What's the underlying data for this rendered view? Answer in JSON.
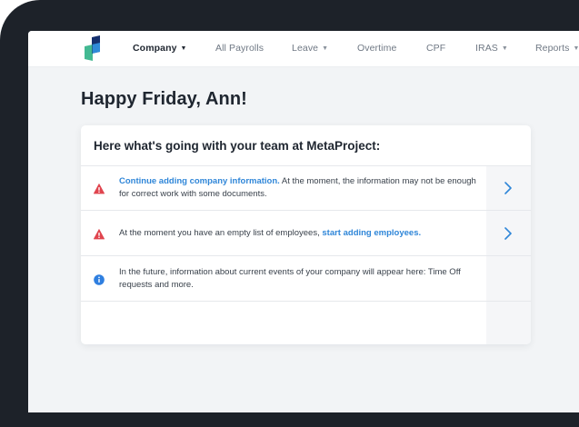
{
  "nav": {
    "items": [
      {
        "label": "Company",
        "active": true,
        "dropdown": true
      },
      {
        "label": "All Payrolls",
        "active": false,
        "dropdown": false
      },
      {
        "label": "Leave",
        "active": false,
        "dropdown": true
      },
      {
        "label": "Overtime",
        "active": false,
        "dropdown": false
      },
      {
        "label": "CPF",
        "active": false,
        "dropdown": false
      },
      {
        "label": "IRAS",
        "active": false,
        "dropdown": true
      },
      {
        "label": "Reports",
        "active": false,
        "dropdown": true
      }
    ],
    "caret": "▼"
  },
  "greeting": "Happy Friday, Ann!",
  "card": {
    "title": "Here what's going with your team at MetaProject:",
    "rows": [
      {
        "icon": "warning-icon",
        "link_text": "Continue adding company information.",
        "text_after": " At the moment, the information may not be enough for correct work with some documents.",
        "has_chevron": true
      },
      {
        "icon": "warning-icon",
        "text_before": "At the moment you have an empty list of employees, ",
        "link_text": "start adding employees.",
        "has_chevron": true
      },
      {
        "icon": "info-icon",
        "text": "In the future, information about current events of your company will appear here: Time Off requests and more.",
        "has_chevron": false
      }
    ]
  },
  "colors": {
    "accent": "#2f86d8",
    "warning": "#e0454f",
    "info": "#2f7fe0",
    "text_dark": "#1f2630",
    "logo_navy": "#15306e",
    "logo_green": "#39b58c",
    "logo_blue": "#2f8ad8"
  }
}
